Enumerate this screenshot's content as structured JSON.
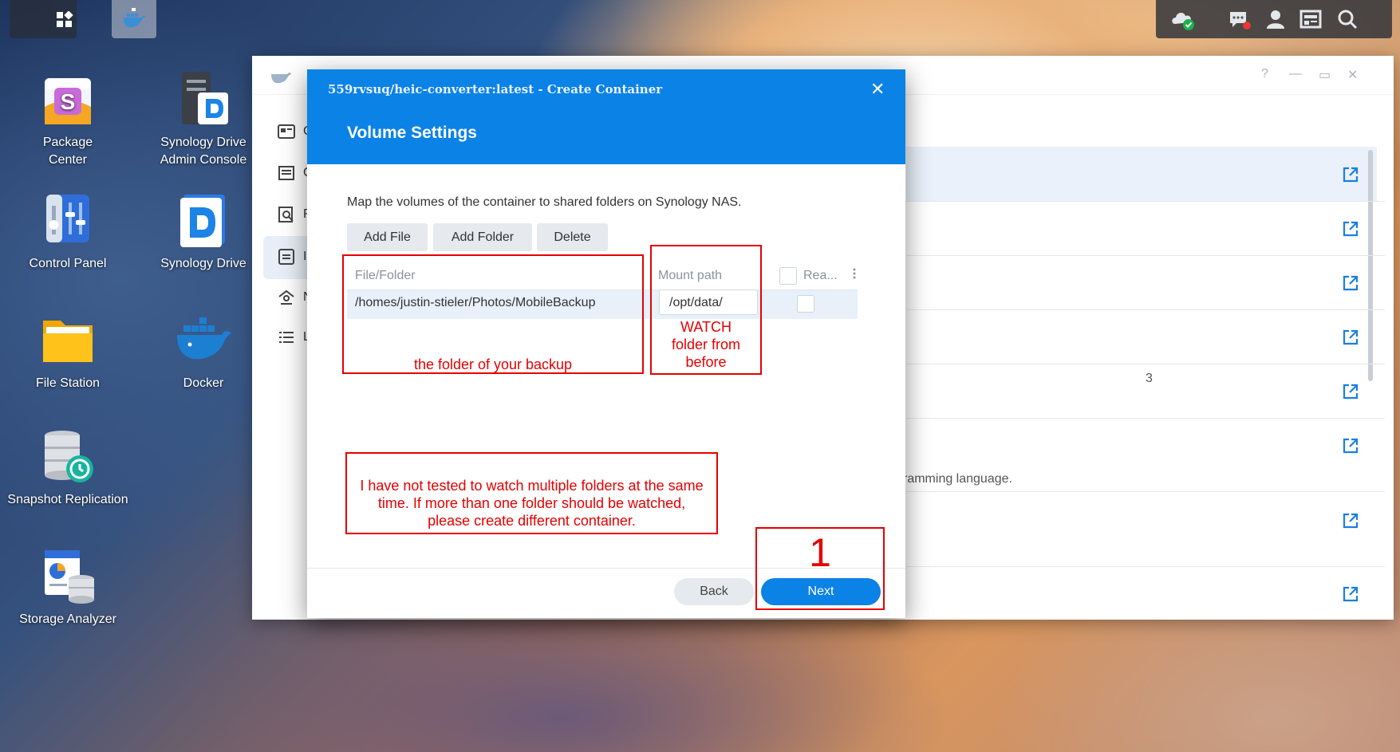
{
  "taskbar": {
    "left_icons": [
      "apps-grid-icon",
      "docker-icon"
    ],
    "right_icons": [
      "cloud-sync-icon",
      "chat-notification-icon",
      "user-icon",
      "widgets-icon",
      "search-icon"
    ]
  },
  "desktop": {
    "icons": [
      {
        "label": "Package\nCenter",
        "icon": "package-center-icon"
      },
      {
        "label": "Synology Drive\nAdmin Console",
        "icon": "synology-drive-admin-icon"
      },
      {
        "label": "Control Panel",
        "icon": "control-panel-icon"
      },
      {
        "label": "Synology Drive",
        "icon": "synology-drive-icon"
      },
      {
        "label": "File Station",
        "icon": "file-station-icon"
      },
      {
        "label": "Docker",
        "icon": "docker-icon"
      },
      {
        "label": "Snapshot Replication",
        "icon": "snapshot-replication-icon"
      },
      {
        "label": "Storage Analyzer",
        "icon": "storage-analyzer-icon"
      }
    ]
  },
  "background_window": {
    "window_controls": [
      "?",
      "—",
      "▭",
      "✕"
    ],
    "sidebar_letters": [
      "C",
      "C",
      "R",
      "I",
      "N",
      "L"
    ],
    "visible_text": "ramming language.",
    "fragment": "3"
  },
  "dialog": {
    "title": "559rvsuq/heic-converter:latest - Create Container",
    "close": "✕",
    "subtitle": "Volume Settings",
    "description": "Map the volumes of the container to shared folders on Synology NAS.",
    "toolbar": {
      "add_file": "Add File",
      "add_folder": "Add Folder",
      "delete": "Delete"
    },
    "table": {
      "columns": {
        "file_folder": "File/Folder",
        "mount_path": "Mount path",
        "read_only": "Rea..."
      },
      "rows": [
        {
          "file_folder": "/homes/justin-stieler/Photos/MobileBackup",
          "mount_path": "/opt/data/",
          "read_only": false
        }
      ]
    },
    "footer": {
      "back": "Back",
      "next": "Next"
    }
  },
  "annotations": {
    "folder_note": "the folder of your backup",
    "watch_note": "WATCH\nfolder from\nbefore",
    "multi_note": "I have not tested to watch multiple folders at the same time. If more than one folder should be watched, please create different container.",
    "step_number": "1"
  },
  "colors": {
    "accent": "#0a82e6",
    "annotation": "#e50000"
  }
}
